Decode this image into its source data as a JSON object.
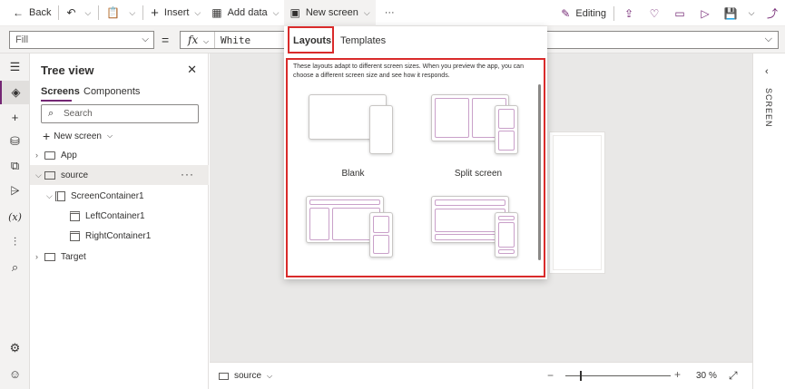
{
  "toolbar": {
    "back_label": "Back",
    "insert_label": "Insert",
    "add_data_label": "Add data",
    "new_screen_label": "New screen",
    "more_label": "···",
    "editing_label": "Editing"
  },
  "formula_bar": {
    "property": "Fill",
    "fx_label": "fx",
    "value": "White"
  },
  "tree_view": {
    "title": "Tree view",
    "tabs": [
      "Screens",
      "Components"
    ],
    "search_placeholder": "Search",
    "new_screen_label": "New screen",
    "items": [
      {
        "label": "App",
        "level": 0,
        "collapsed": true
      },
      {
        "label": "source",
        "level": 0,
        "expanded": true,
        "selected": true
      },
      {
        "label": "ScreenContainer1",
        "level": 1
      },
      {
        "label": "LeftContainer1",
        "level": 2
      },
      {
        "label": "RightContainer1",
        "level": 2
      },
      {
        "label": "Target",
        "level": 0,
        "collapsed": true
      }
    ]
  },
  "dropdown": {
    "tabs": [
      "Layouts",
      "Templates"
    ],
    "selected_tab": "Layouts",
    "description": "These layouts adapt to different screen sizes. When you preview the app, you can choose a different screen size and see how it responds.",
    "layouts": [
      {
        "label": "Blank"
      },
      {
        "label": "Split screen"
      }
    ]
  },
  "status_bar": {
    "screen_label": "source",
    "zoom_value": "30",
    "zoom_unit": "%",
    "zoom_level": 0.3
  },
  "right_panel": {
    "label": "SCREEN"
  },
  "colors": {
    "accent": "#742774",
    "highlight": "#d92b2b"
  }
}
